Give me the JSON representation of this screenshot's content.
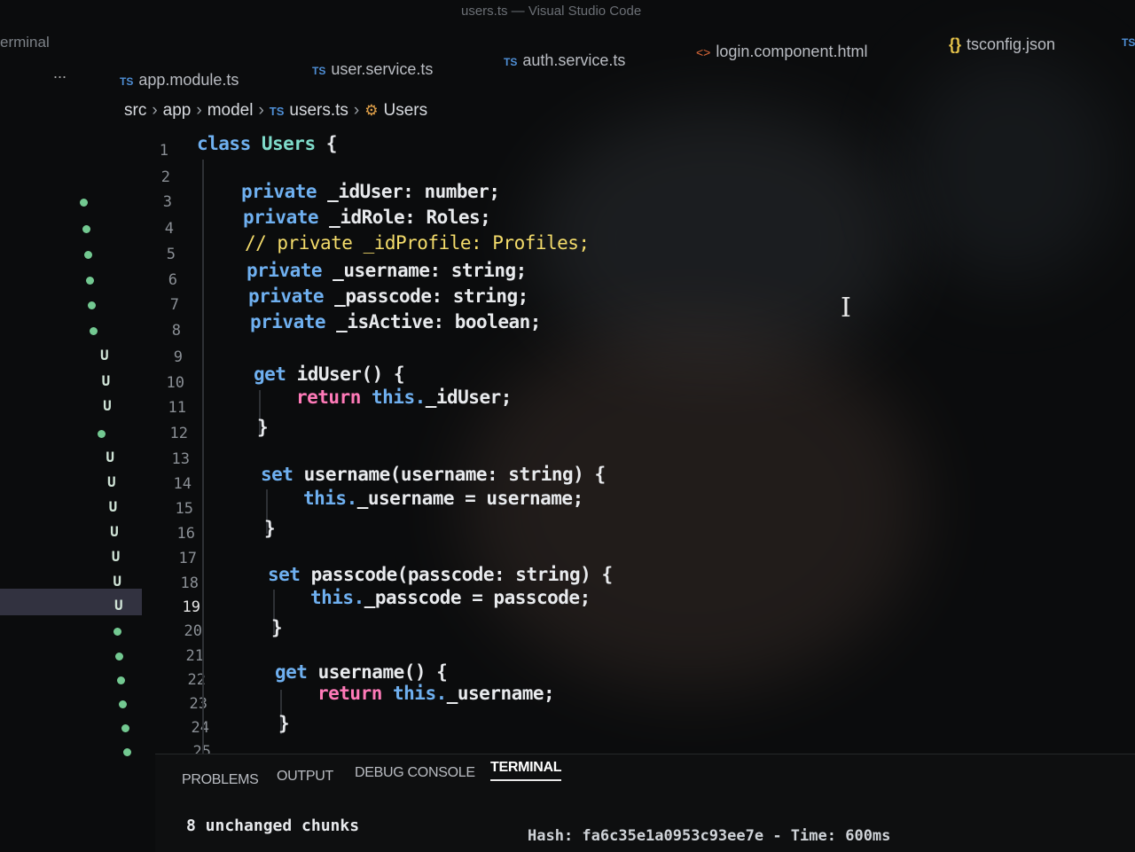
{
  "window": {
    "title": "users.ts — Visual Studio Code",
    "side_label": "erminal"
  },
  "tabs": {
    "more": "...",
    "items": [
      {
        "label": "app.module.ts",
        "kind": "TS"
      },
      {
        "label": "user.service.ts",
        "kind": "TS"
      },
      {
        "label": "auth.service.ts",
        "kind": "TS"
      },
      {
        "label": "login.component.html",
        "kind": "html"
      },
      {
        "label": "tsconfig.json",
        "kind": "json"
      }
    ],
    "overflow": "TS"
  },
  "breadcrumb": {
    "src": "src",
    "app": "app",
    "model": "model",
    "file": "users.ts",
    "file_kind": "TS",
    "symbol": "Users"
  },
  "gutter": {
    "line_numbers": [
      "1",
      "2",
      "3",
      "4",
      "5",
      "6",
      "7",
      "8",
      "9",
      "10",
      "11",
      "12",
      "13",
      "14",
      "15",
      "16",
      "17",
      "18",
      "19",
      "20",
      "21",
      "22",
      "23",
      "24",
      "25"
    ],
    "current_line": "19"
  },
  "code": {
    "l1_kw": "class",
    "l1_name": "Users",
    "l1_brace": "{",
    "l3_kw": "private",
    "l3_rest": "_idUser: number;",
    "l4_kw": "private",
    "l4_rest": "_idRole: Roles;",
    "l5": "// private _idProfile: Profiles;",
    "l6_kw": "private",
    "l6_rest": "_username: string;",
    "l7_kw": "private",
    "l7_rest": "_passcode: string;",
    "l8_kw": "private",
    "l8_rest": "_isActive: boolean;",
    "l10_kw": "get",
    "l10_rest": "idUser() {",
    "l11_kw": "return",
    "l11_this": "this.",
    "l11_rest": "_idUser;",
    "l12": "}",
    "l14_kw": "set",
    "l14_rest": "username(username: string) {",
    "l15_this": "this.",
    "l15_rest": "_username = username;",
    "l16": "}",
    "l18_kw": "set",
    "l18_rest": "passcode(passcode: string) {",
    "l19_this": "this.",
    "l19_rest": "_passcode = passcode;",
    "l20": "}",
    "l22_kw": "get",
    "l22_rest": "username() {",
    "l23_kw": "return",
    "l23_this": "this.",
    "l23_rest": "_username;",
    "l24": "}"
  },
  "panel": {
    "tabs": [
      "PROBLEMS",
      "OUTPUT",
      "DEBUG CONSOLE",
      "TERMINAL"
    ],
    "active_tab": "TERMINAL",
    "terminal_line": "8 unchanged chunks",
    "terminal_line2": "Hash: fa6c35e1a0953c93ee7e - Time: 600ms"
  },
  "colors": {
    "keyword": "#6fb0f0",
    "control": "#ff7ab8",
    "comment": "#f4dc6b",
    "modified_marker": "#73c991"
  }
}
